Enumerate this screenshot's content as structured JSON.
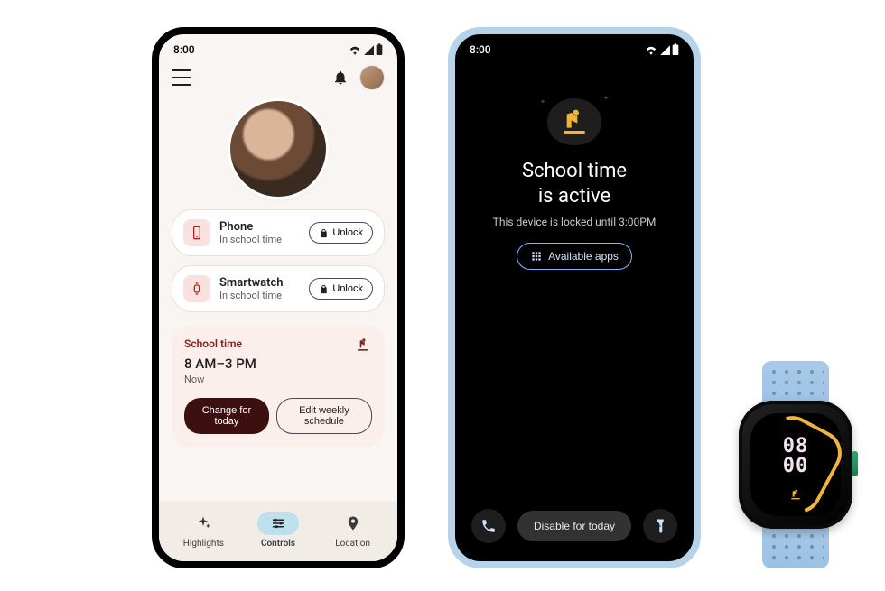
{
  "status": {
    "time": "8:00"
  },
  "phone1": {
    "devices": [
      {
        "name": "Phone",
        "subtitle": "In school time",
        "unlock": "Unlock"
      },
      {
        "name": "Smartwatch",
        "subtitle": "In school time",
        "unlock": "Unlock"
      }
    ],
    "school": {
      "title": "School time",
      "range": "8 AM–3 PM",
      "now": "Now",
      "change": "Change for today",
      "edit": "Edit weekly schedule"
    },
    "nav": {
      "highlights": "Highlights",
      "controls": "Controls",
      "location": "Location",
      "active": "controls"
    }
  },
  "phone2": {
    "heading_l1": "School time",
    "heading_l2": "is active",
    "subtitle": "This device is locked until 3:00PM",
    "available": "Available apps",
    "disable": "Disable for today"
  },
  "watch": {
    "time_l1": "08",
    "time_l2": "00"
  },
  "colors": {
    "accent_red": "#8c1d18",
    "accent_blue": "#bde0ec",
    "accent_amber": "#f0b43c"
  }
}
